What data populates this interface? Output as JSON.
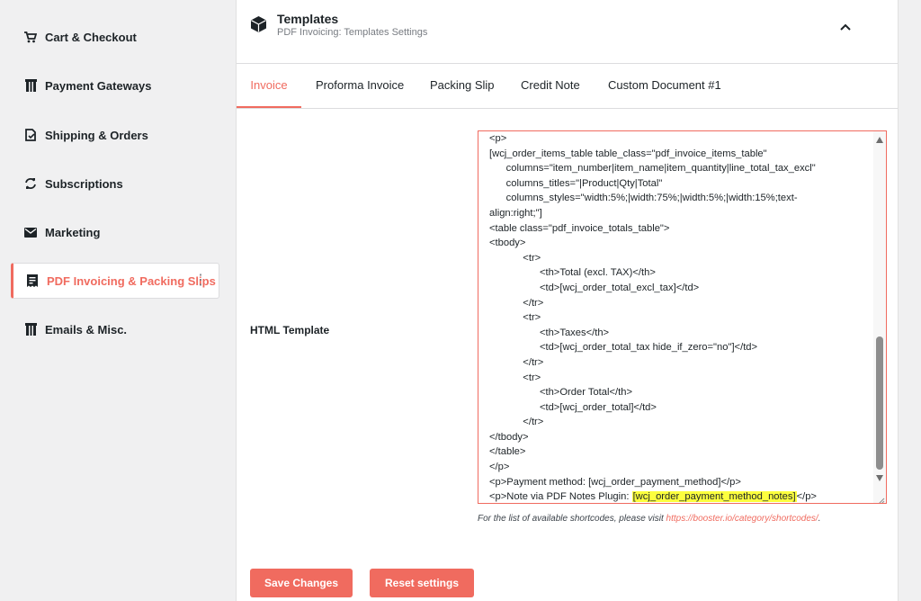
{
  "sidebar": {
    "items": [
      {
        "label": "Cart & Checkout",
        "icon": "cart-icon"
      },
      {
        "label": "Payment Gateways",
        "icon": "gateway-icon"
      },
      {
        "label": "Shipping & Orders",
        "icon": "shipping-icon"
      },
      {
        "label": "Subscriptions",
        "icon": "refresh-icon"
      },
      {
        "label": "Marketing",
        "icon": "envelope-icon"
      },
      {
        "label": "PDF Invoicing & Packing Slips",
        "icon": "invoice-icon",
        "active": true
      },
      {
        "label": "Emails & Misc.",
        "icon": "emails-icon"
      }
    ]
  },
  "panel": {
    "title": "Templates",
    "subtitle": "PDF Invoicing: Templates Settings",
    "icon": "box-icon"
  },
  "tabs": [
    "Invoice",
    "Proforma Invoice",
    "Packing Slip",
    "Credit Note",
    "Custom Document #1"
  ],
  "active_tab": "Invoice",
  "field": {
    "label": "HTML Template",
    "lines": [
      "<p>",
      "[wcj_order_items_table table_class=\"pdf_invoice_items_table\"",
      "      columns=\"item_number|item_name|item_quantity|line_total_tax_excl\"",
      "      columns_titles=\"|Product|Qty|Total\"",
      "      columns_styles=\"width:5%;|width:75%;|width:5%;|width:15%;text-",
      "align:right;\"]",
      "<table class=\"pdf_invoice_totals_table\">",
      "<tbody>",
      "            <tr>",
      "                  <th>Total (excl. TAX)</th>",
      "                  <td>[wcj_order_total_excl_tax]</td>",
      "            </tr>",
      "            <tr>",
      "                  <th>Taxes</th>",
      "                  <td>[wcj_order_total_tax hide_if_zero=\"no\"]</td>",
      "            </tr>",
      "            <tr>",
      "                  <th>Order Total</th>",
      "                  <td>[wcj_order_total]</td>",
      "            </tr>",
      "</tbody>",
      "</table>",
      "</p>",
      "<p>Payment method: [wcj_order_payment_method]</p>"
    ],
    "last_line_prefix": "<p>Note via PDF Notes Plugin: ",
    "last_line_highlight": "[wcj_order_payment_method_notes]",
    "last_line_suffix": "</p>"
  },
  "help": {
    "text": "For the list of available shortcodes, please visit ",
    "link": "https://booster.io/category/shortcodes/",
    "tail": "."
  },
  "buttons": {
    "save": "Save Changes",
    "reset": "Reset settings"
  },
  "colors": {
    "accent": "#f06b5f",
    "highlight": "#fcff3e"
  }
}
